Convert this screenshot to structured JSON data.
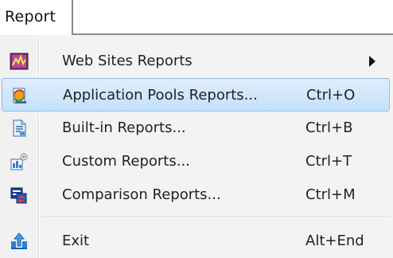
{
  "menubar": {
    "label": "Report"
  },
  "menu": {
    "items": [
      {
        "label": "Web Sites Reports",
        "shortcut": "",
        "icon": "web-sites-report-icon",
        "has_submenu": true,
        "highlighted": false
      },
      {
        "label": "Application Pools Reports...",
        "shortcut": "Ctrl+O",
        "icon": "application-pools-report-icon",
        "has_submenu": false,
        "highlighted": true
      },
      {
        "label": "Built-in Reports...",
        "shortcut": "Ctrl+B",
        "icon": "built-in-report-icon",
        "has_submenu": false,
        "highlighted": false
      },
      {
        "label": "Custom Reports...",
        "shortcut": "Ctrl+T",
        "icon": "custom-report-icon",
        "has_submenu": false,
        "highlighted": false
      },
      {
        "label": "Comparison Reports...",
        "shortcut": "Ctrl+M",
        "icon": "comparison-report-icon",
        "has_submenu": false,
        "highlighted": false
      },
      {
        "label": "Exit",
        "shortcut": "Alt+End",
        "icon": "exit-icon",
        "has_submenu": false,
        "highlighted": false
      }
    ]
  },
  "colors": {
    "highlight_top": "#dfeefc",
    "highlight_bottom": "#c5e1fb",
    "highlight_border": "#8fbde6",
    "menu_background": "#f3f3f3"
  }
}
